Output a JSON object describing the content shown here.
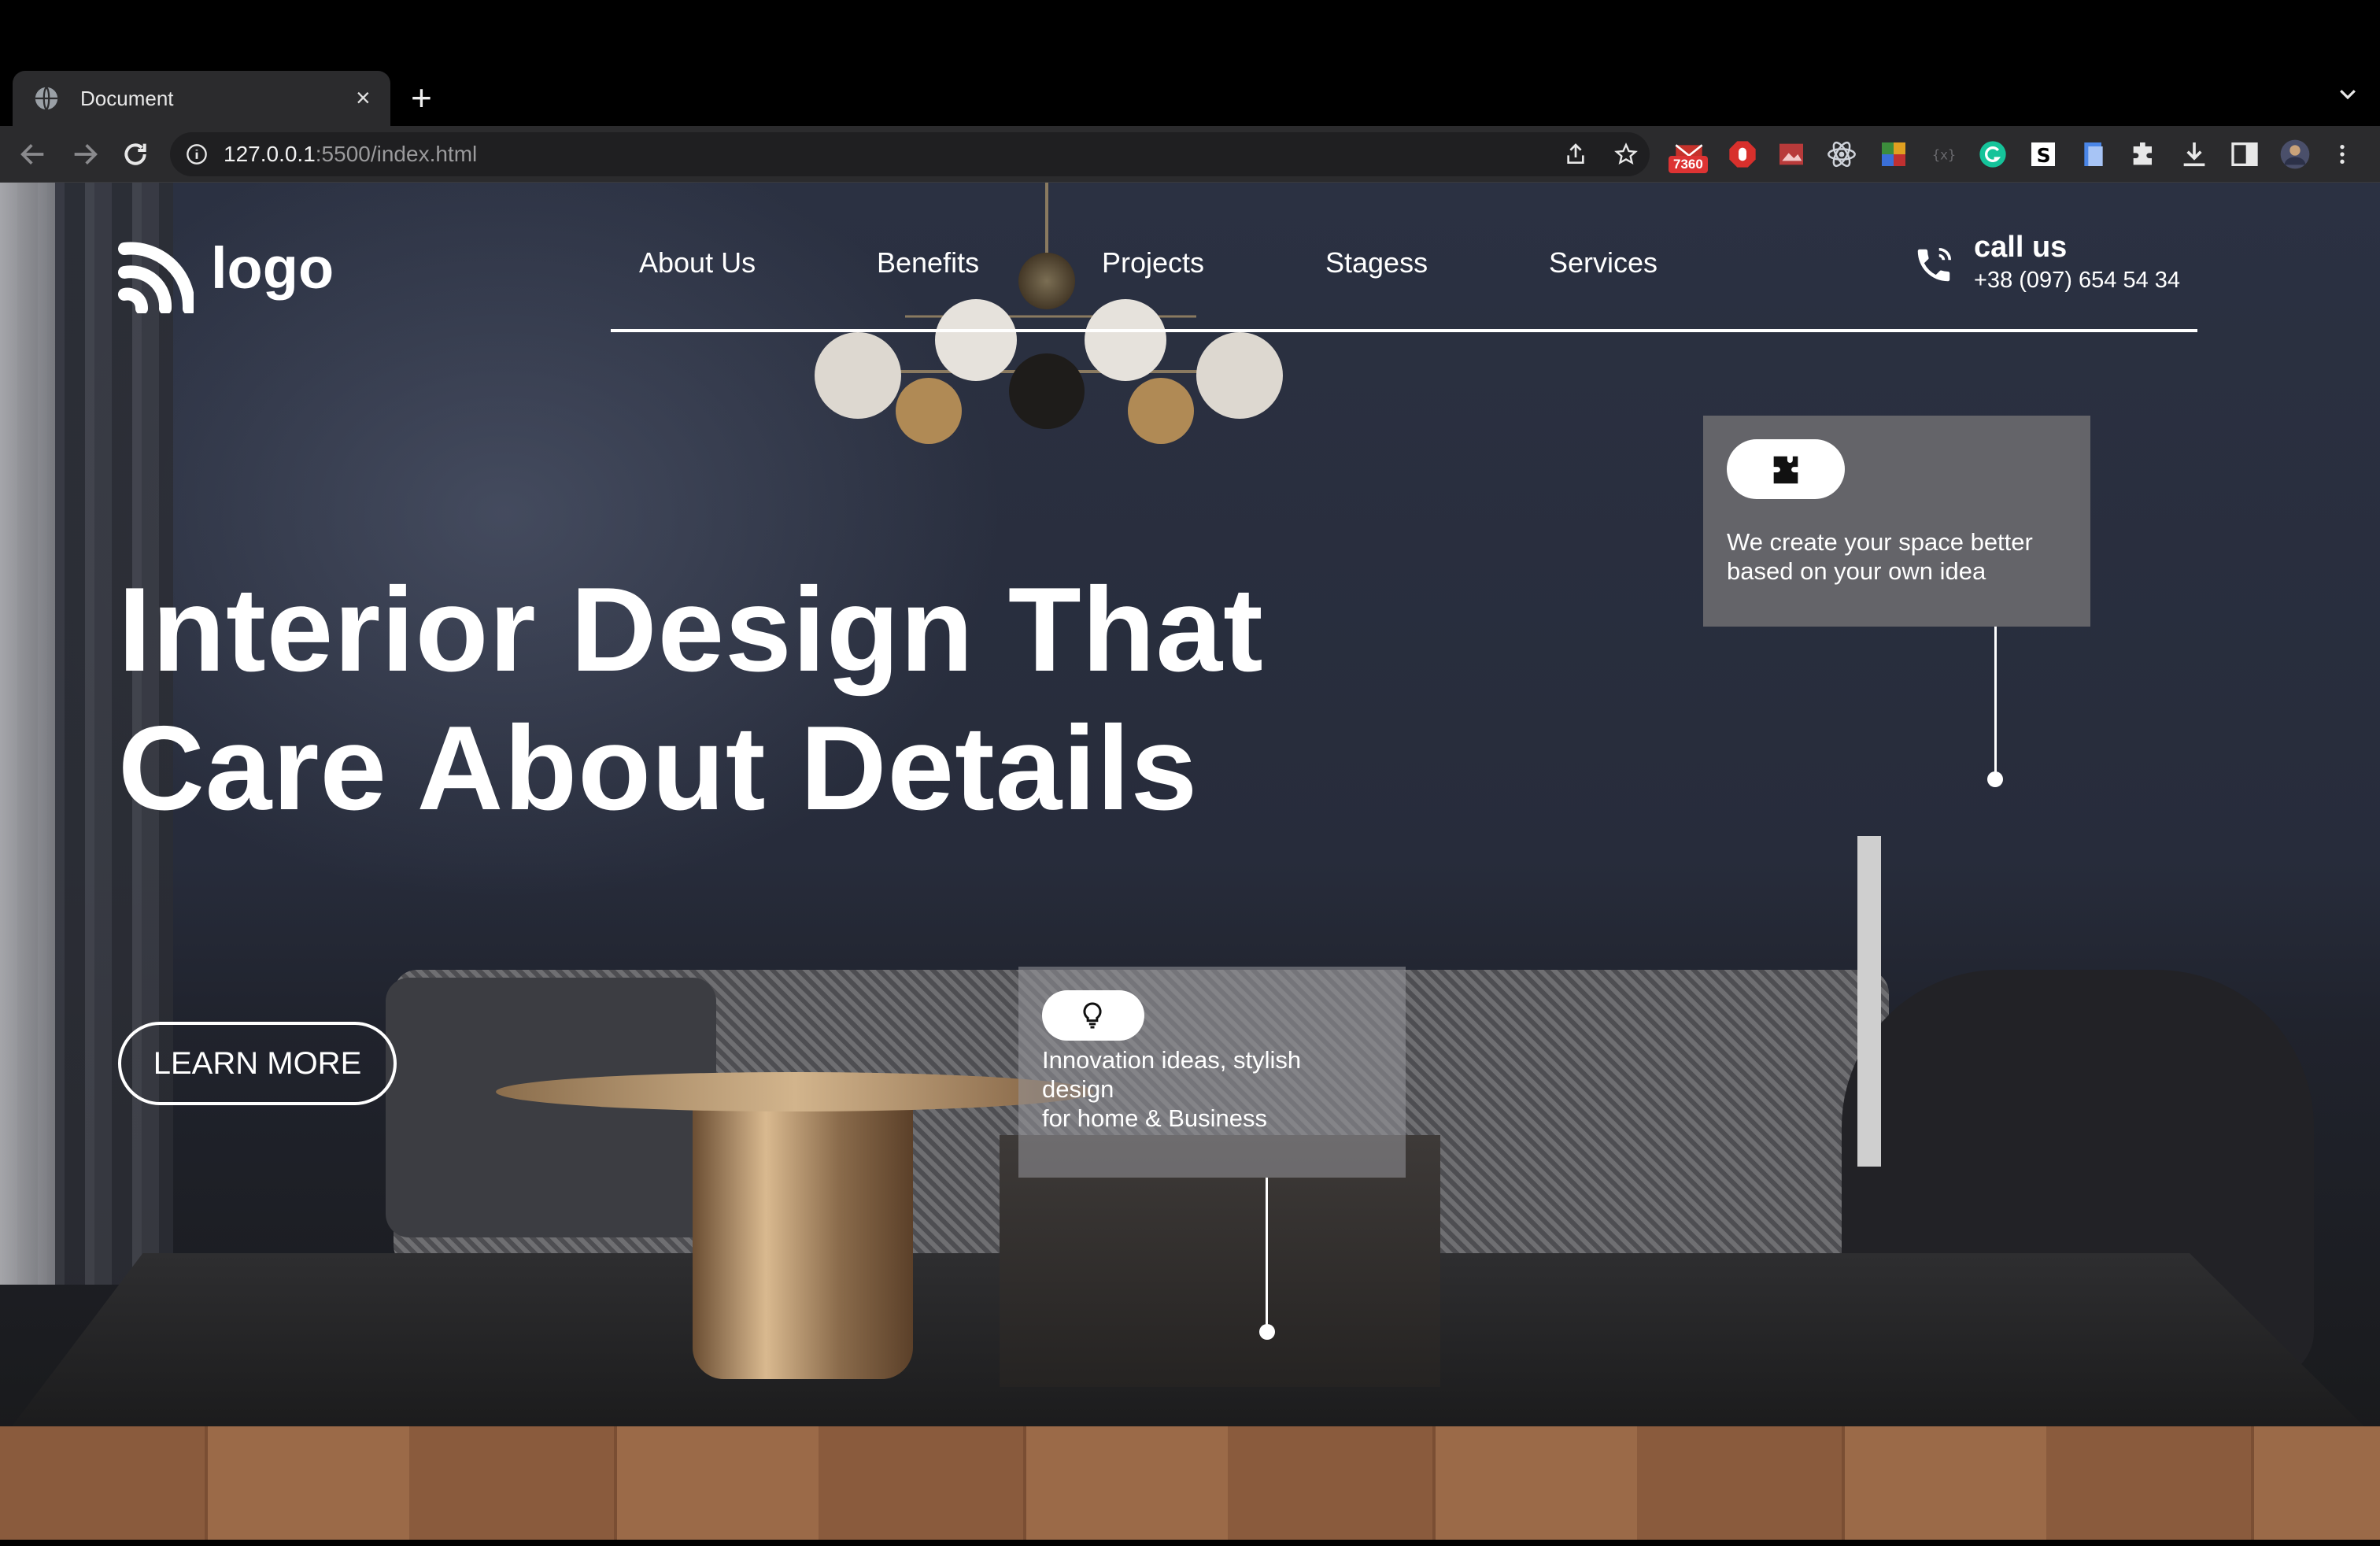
{
  "browser": {
    "tab_title": "Document",
    "tab_close": "×",
    "new_tab": "+",
    "url_host": "127.0.0.1",
    "url_path": ":5500/index.html",
    "extension_badge": "7360"
  },
  "site": {
    "logo_text": "logo",
    "nav": [
      "About Us",
      "Benefits",
      "Projects",
      "Stagess",
      "Services"
    ],
    "call": {
      "title": "call us",
      "number": "+38 (097) 654 54 34"
    },
    "headline": [
      "Interior Design That",
      "Care About Details"
    ],
    "cta_label": "LEARN MORE",
    "card1": {
      "icon": "puzzle-icon",
      "lines": [
        "We create your space better",
        "based on your own idea"
      ]
    },
    "card2": {
      "icon": "lightbulb-icon",
      "lines": [
        "Innovation ideas, stylish",
        "design",
        "for home & Business"
      ]
    }
  },
  "colors": {
    "chrome_bg": "#2b2b2d",
    "page_text": "#ffffff",
    "card_bg": "#69696c"
  }
}
